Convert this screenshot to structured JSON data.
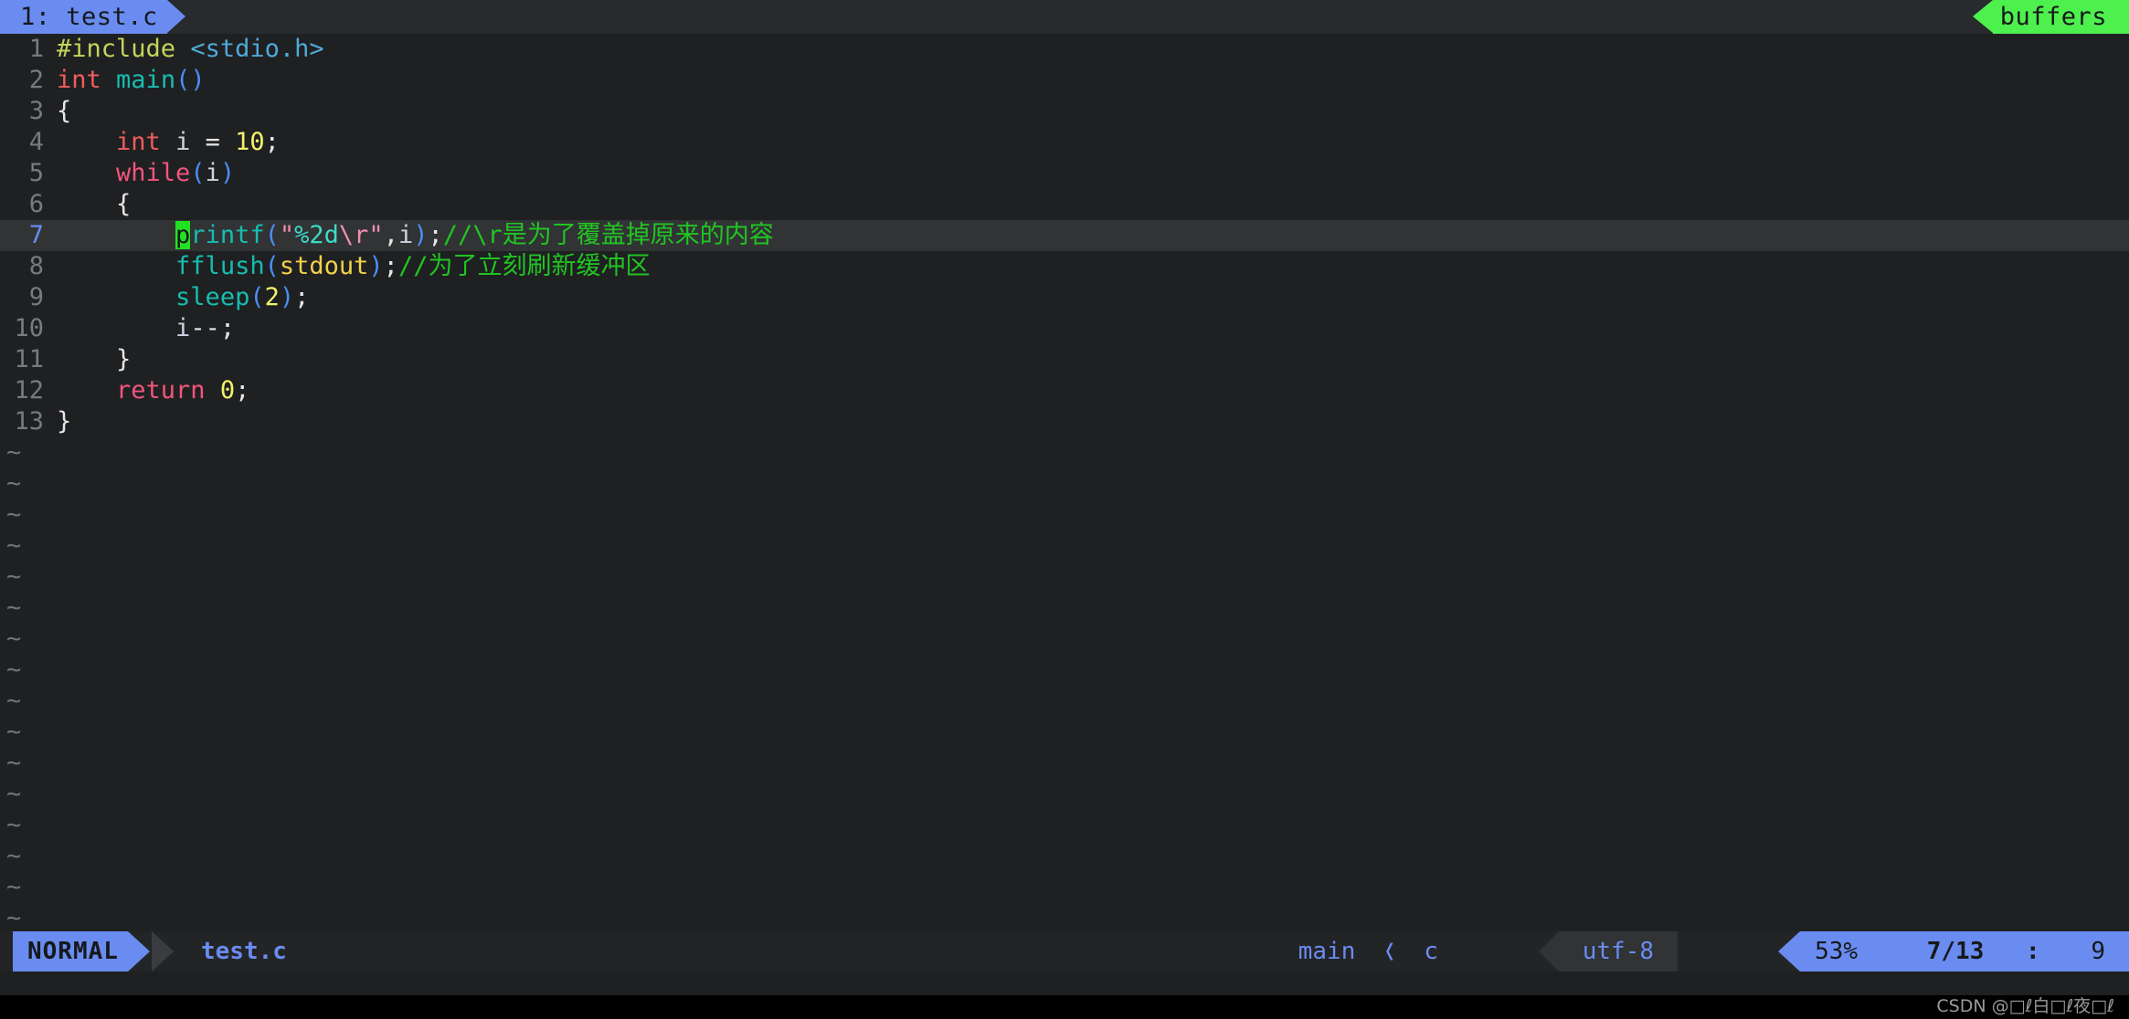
{
  "app": {
    "name": "neovim",
    "theme_bg": "#1f2022"
  },
  "tabline": {
    "active_tab": "1: test.c",
    "right_label": "buffers",
    "active_tab_bg": "#6a8cf0",
    "right_label_bg": "#4ef04e"
  },
  "editor": {
    "cursor_line": 7,
    "lines": [
      {
        "num": "1",
        "tokens": [
          {
            "t": "#include ",
            "c": "t-pre"
          },
          {
            "t": "<stdio.h>",
            "c": "t-inc"
          }
        ]
      },
      {
        "num": "2",
        "tokens": [
          {
            "t": "int",
            "c": "t-type"
          },
          {
            "t": " ",
            "c": "t-punct"
          },
          {
            "t": "main",
            "c": "t-func"
          },
          {
            "t": "()",
            "c": "t-paren"
          }
        ]
      },
      {
        "num": "3",
        "tokens": [
          {
            "t": "{",
            "c": "t-punct"
          }
        ]
      },
      {
        "num": "4",
        "tokens": [
          {
            "t": "    ",
            "c": "t-punct"
          },
          {
            "t": "int",
            "c": "t-type"
          },
          {
            "t": " ",
            "c": "t-punct"
          },
          {
            "t": "i",
            "c": "t-ident"
          },
          {
            "t": " = ",
            "c": "t-punct"
          },
          {
            "t": "10",
            "c": "t-num"
          },
          {
            "t": ";",
            "c": "t-punct"
          }
        ]
      },
      {
        "num": "5",
        "tokens": [
          {
            "t": "    ",
            "c": "t-punct"
          },
          {
            "t": "while",
            "c": "t-kw"
          },
          {
            "t": "(",
            "c": "t-paren"
          },
          {
            "t": "i",
            "c": "t-ident"
          },
          {
            "t": ")",
            "c": "t-paren"
          }
        ]
      },
      {
        "num": "6",
        "tokens": [
          {
            "t": "    ",
            "c": "t-punct"
          },
          {
            "t": "{",
            "c": "t-punct"
          }
        ]
      },
      {
        "num": "7",
        "tokens": [
          {
            "t": "        ",
            "c": "t-punct"
          },
          {
            "t": "p",
            "c": "cursor"
          },
          {
            "t": "rintf",
            "c": "t-func"
          },
          {
            "t": "(",
            "c": "t-paren"
          },
          {
            "t": "\"",
            "c": "t-str"
          },
          {
            "t": "%2d",
            "c": "t-fmt"
          },
          {
            "t": "\\r",
            "c": "t-esc"
          },
          {
            "t": "\"",
            "c": "t-str"
          },
          {
            "t": ",",
            "c": "t-punct"
          },
          {
            "t": "i",
            "c": "t-ident"
          },
          {
            "t": ")",
            "c": "t-paren"
          },
          {
            "t": ";",
            "c": "t-punct"
          },
          {
            "t": "//\\r是为了覆盖掉原来的内容",
            "c": "t-cmt"
          }
        ]
      },
      {
        "num": "8",
        "tokens": [
          {
            "t": "        ",
            "c": "t-punct"
          },
          {
            "t": "fflush",
            "c": "t-func"
          },
          {
            "t": "(",
            "c": "t-paren"
          },
          {
            "t": "stdout",
            "c": "t-stdout"
          },
          {
            "t": ")",
            "c": "t-paren"
          },
          {
            "t": ";",
            "c": "t-punct"
          },
          {
            "t": "//为了立刻刷新缓冲区",
            "c": "t-cmt"
          }
        ]
      },
      {
        "num": "9",
        "tokens": [
          {
            "t": "        ",
            "c": "t-punct"
          },
          {
            "t": "sleep",
            "c": "t-func"
          },
          {
            "t": "(",
            "c": "t-paren"
          },
          {
            "t": "2",
            "c": "t-num"
          },
          {
            "t": ")",
            "c": "t-paren"
          },
          {
            "t": ";",
            "c": "t-punct"
          }
        ]
      },
      {
        "num": "10",
        "tokens": [
          {
            "t": "        ",
            "c": "t-punct"
          },
          {
            "t": "i",
            "c": "t-ident"
          },
          {
            "t": "--;",
            "c": "t-punct"
          }
        ]
      },
      {
        "num": "11",
        "tokens": [
          {
            "t": "    ",
            "c": "t-punct"
          },
          {
            "t": "}",
            "c": "t-punct"
          }
        ]
      },
      {
        "num": "12",
        "tokens": [
          {
            "t": "    ",
            "c": "t-punct"
          },
          {
            "t": "return",
            "c": "t-kw"
          },
          {
            "t": " ",
            "c": "t-punct"
          },
          {
            "t": "0",
            "c": "t-num"
          },
          {
            "t": ";",
            "c": "t-punct"
          }
        ]
      },
      {
        "num": "13",
        "tokens": [
          {
            "t": "}",
            "c": "t-punct"
          }
        ]
      }
    ],
    "filler_char": "~",
    "filler_count": 16
  },
  "statusline": {
    "mode": "NORMAL",
    "filename": "test.c",
    "branch": "main",
    "branch_separator": "❬",
    "filetype": "c",
    "encoding": "utf-8",
    "percent": "53%",
    "line_of_total": "7/13",
    "colon": ":",
    "column": "9"
  },
  "watermark": {
    "text": "CSDN @□ℓ白□ℓ夜□ℓ"
  }
}
